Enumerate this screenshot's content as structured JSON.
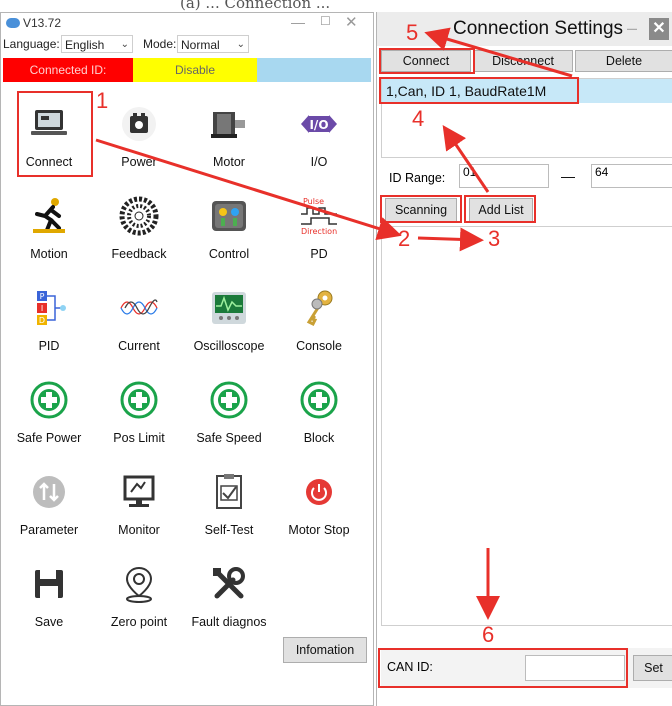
{
  "caption": "(a) ... Connection ...",
  "left_window": {
    "title": "V13.72",
    "language_label": "Language:",
    "language_value": "English",
    "mode_label": "Mode:",
    "mode_value": "Normal",
    "connected_id": "Connected ID:",
    "enable_state": "Disable",
    "tiles": [
      {
        "label": "Connect",
        "icon": "laptop-icon"
      },
      {
        "label": "Power",
        "icon": "battery-icon"
      },
      {
        "label": "Motor",
        "icon": "motor-icon"
      },
      {
        "label": "I/O",
        "icon": "io-icon"
      },
      {
        "label": "Motion",
        "icon": "runner-icon"
      },
      {
        "label": "Feedback",
        "icon": "encoder-icon"
      },
      {
        "label": "Control",
        "icon": "control-knobs-icon"
      },
      {
        "label": "PD",
        "icon": "pulse-direction-icon"
      },
      {
        "label": "PID",
        "icon": "pid-icon"
      },
      {
        "label": "Current",
        "icon": "sine-waves-icon"
      },
      {
        "label": "Oscilloscope",
        "icon": "oscilloscope-icon"
      },
      {
        "label": "Console",
        "icon": "keys-icon"
      },
      {
        "label": "Safe Power",
        "icon": "safety-cross-icon"
      },
      {
        "label": "Pos Limit",
        "icon": "safety-cross-icon"
      },
      {
        "label": "Safe Speed",
        "icon": "safety-cross-icon"
      },
      {
        "label": "Block",
        "icon": "safety-cross-icon"
      },
      {
        "label": "Parameter",
        "icon": "parameter-icon"
      },
      {
        "label": "Monitor",
        "icon": "monitor-icon"
      },
      {
        "label": "Self-Test",
        "icon": "checklist-icon"
      },
      {
        "label": "Motor Stop",
        "icon": "power-button-icon"
      },
      {
        "label": "Save",
        "icon": "floppy-disk-icon"
      },
      {
        "label": "Zero point",
        "icon": "location-pin-icon"
      },
      {
        "label": "Fault diagnos",
        "icon": "tools-icon"
      }
    ],
    "info_button": "Infomation",
    "pulse_text": "Pulse",
    "direction_text": "Direction",
    "io_text": "I/O",
    "pid_letters": [
      "P",
      "I",
      "D"
    ]
  },
  "right_window": {
    "title": "Connection Settings",
    "minimize": "–",
    "close": "✕",
    "connect_button": "Connect",
    "disconnect_button": "Disconnect",
    "delete_button": "Delete",
    "device_item": "1,Can, ID 1, BaudRate1M",
    "id_range_label": "ID Range:",
    "id_range_from": "01",
    "id_range_dash": "—",
    "id_range_to": "64",
    "scanning_button": "Scanning",
    "add_list_button": "Add List",
    "can_id_label": "CAN ID:",
    "can_id_value": "",
    "set_button": "Set"
  },
  "annotations": [
    "1",
    "2",
    "3",
    "4",
    "5",
    "6"
  ],
  "colors": {
    "annotation": "#e8302a",
    "status_red": "#ff0000",
    "status_yellow": "#ffff00",
    "status_blue": "#a8d8f0",
    "selected_item": "#c7e8f8"
  }
}
